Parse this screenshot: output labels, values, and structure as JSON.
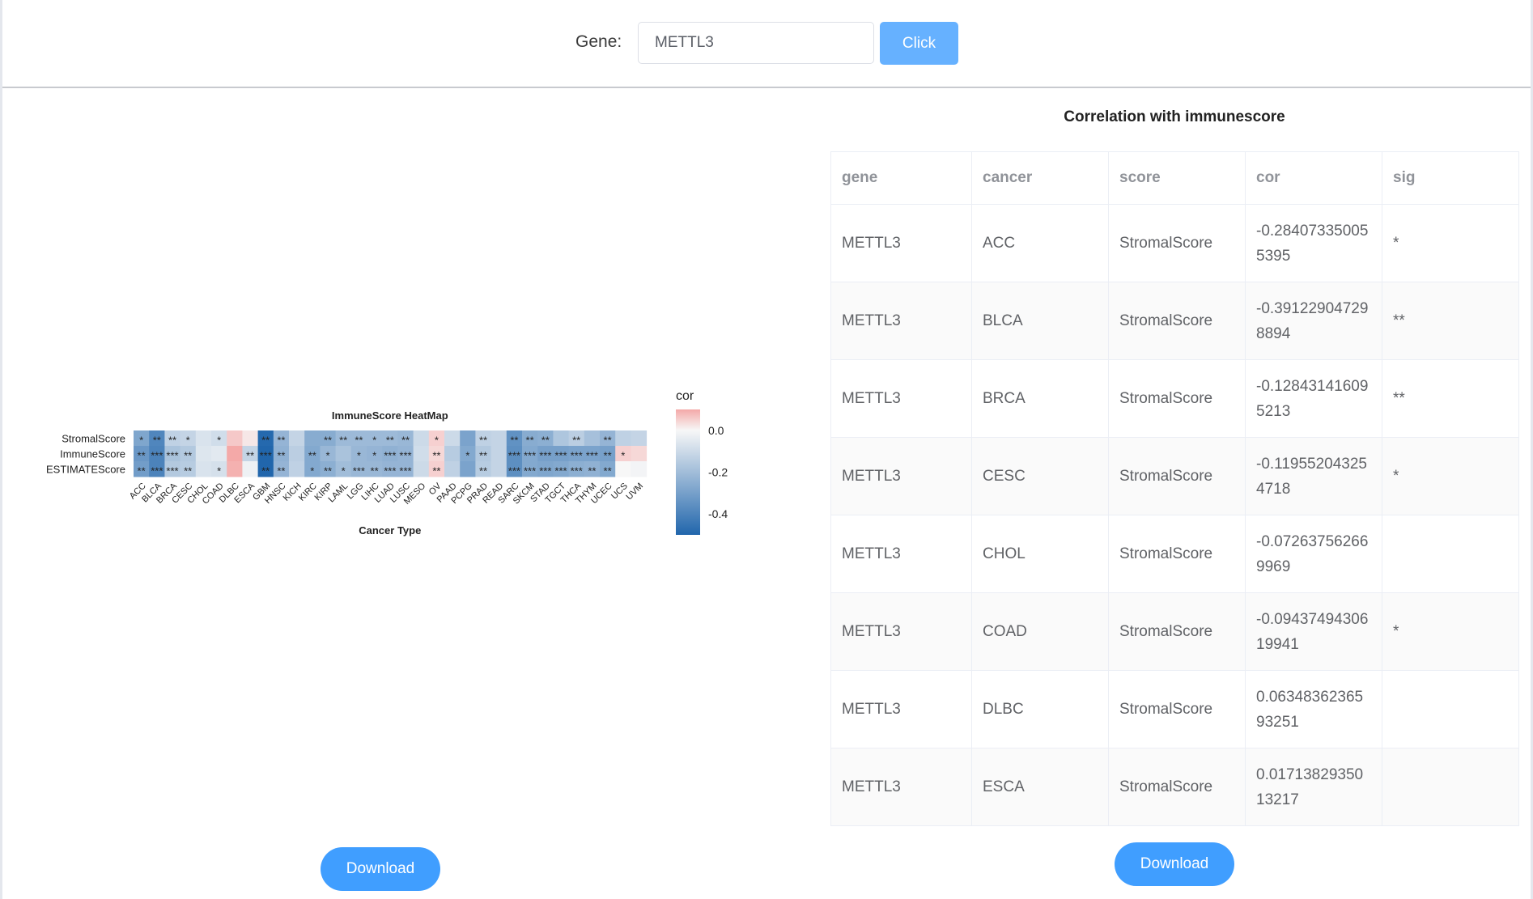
{
  "search": {
    "label": "Gene:",
    "value": "METTL3",
    "button_label": "Click"
  },
  "heatmap": {
    "title": "ImmuneScore HeatMap",
    "xlabel": "Cancer Type",
    "legend_title": "cor",
    "legend_ticks": [
      "0.0",
      "-0.2",
      "-0.4"
    ],
    "download_label": "Download"
  },
  "chart_data": {
    "type": "heatmap",
    "title": "ImmuneScore HeatMap",
    "xlabel": "Cancer Type",
    "ylabel": "",
    "rows": [
      "StromalScore",
      "ImmuneScore",
      "ESTIMATEScore"
    ],
    "columns": [
      "ACC",
      "BLCA",
      "BRCA",
      "CESC",
      "CHOL",
      "COAD",
      "DLBC",
      "ESCA",
      "GBM",
      "HNSC",
      "KICH",
      "KIRC",
      "KIRP",
      "LAML",
      "LGG",
      "LIHC",
      "LUAD",
      "LUSC",
      "MESO",
      "OV",
      "PAAD",
      "PCPG",
      "PRAD",
      "READ",
      "SARC",
      "SKCM",
      "STAD",
      "TGCT",
      "THCA",
      "THYM",
      "UCEC",
      "UCS",
      "UVM"
    ],
    "values": [
      [
        -0.28,
        -0.39,
        -0.13,
        -0.12,
        -0.07,
        -0.09,
        0.06,
        0.02,
        -0.49,
        -0.23,
        -0.12,
        -0.26,
        -0.26,
        -0.21,
        -0.21,
        -0.21,
        -0.21,
        -0.22,
        -0.1,
        0.05,
        -0.1,
        -0.29,
        -0.13,
        -0.12,
        -0.35,
        -0.26,
        -0.25,
        -0.17,
        -0.14,
        -0.19,
        -0.23,
        -0.13,
        -0.12
      ],
      [
        -0.33,
        -0.4,
        -0.18,
        -0.16,
        -0.06,
        -0.05,
        0.1,
        -0.12,
        -0.5,
        -0.24,
        -0.14,
        -0.27,
        -0.22,
        -0.18,
        -0.22,
        -0.23,
        -0.24,
        -0.23,
        -0.09,
        0.04,
        -0.15,
        -0.27,
        -0.16,
        -0.12,
        -0.36,
        -0.27,
        -0.3,
        -0.3,
        -0.29,
        -0.29,
        -0.3,
        0.05,
        0.04
      ],
      [
        -0.31,
        -0.4,
        -0.16,
        -0.15,
        -0.07,
        -0.08,
        0.09,
        -0.02,
        -0.5,
        -0.23,
        -0.13,
        -0.27,
        -0.25,
        -0.2,
        -0.22,
        -0.22,
        -0.23,
        -0.23,
        -0.1,
        0.05,
        -0.13,
        -0.29,
        -0.15,
        -0.12,
        -0.36,
        -0.27,
        -0.28,
        -0.27,
        -0.25,
        -0.24,
        -0.27,
        0.0,
        -0.01
      ]
    ],
    "sig": [
      [
        "*",
        "**",
        "**",
        "*",
        "",
        "*",
        "",
        "",
        "**",
        "**",
        "",
        "",
        "**",
        "**",
        "**",
        "*",
        "**",
        "**",
        "",
        "*",
        "",
        "",
        "**",
        "",
        "**",
        "**",
        "**",
        "",
        "**",
        "",
        "**",
        "",
        ""
      ],
      [
        "**",
        "***",
        "***",
        "**",
        "",
        "",
        "",
        "**",
        "***",
        "**",
        "",
        "**",
        "*",
        "",
        "*",
        "*",
        "***",
        "***",
        "",
        "**",
        "",
        "*",
        "**",
        "",
        "***",
        "***",
        "***",
        "***",
        "***",
        "***",
        "**",
        "*",
        ""
      ],
      [
        "**",
        "***",
        "***",
        "**",
        "",
        "*",
        "",
        "",
        "**",
        "**",
        "",
        "*",
        "**",
        "*",
        "***",
        "**",
        "***",
        "***",
        "",
        "**",
        "",
        "",
        "**",
        "",
        "***",
        "***",
        "***",
        "***",
        "***",
        "**",
        "**",
        "",
        ""
      ]
    ],
    "colorbar": {
      "min": -0.5,
      "max": 0.1,
      "ticks": [
        0.0,
        -0.2,
        -0.4
      ],
      "low_color": "#2166ac",
      "mid_color": "#f7f7f7",
      "high_color": "#f4a9a8"
    }
  },
  "table": {
    "title": "Correlation with immunescore",
    "headers": [
      "gene",
      "cancer",
      "score",
      "cor",
      "sig"
    ],
    "rows": [
      {
        "gene": "METTL3",
        "cancer": "ACC",
        "score": "StromalScore",
        "cor": "-0.284073350055395",
        "sig": "*"
      },
      {
        "gene": "METTL3",
        "cancer": "BLCA",
        "score": "StromalScore",
        "cor": "-0.391229047298894",
        "sig": "**"
      },
      {
        "gene": "METTL3",
        "cancer": "BRCA",
        "score": "StromalScore",
        "cor": "-0.128431416095213",
        "sig": "**"
      },
      {
        "gene": "METTL3",
        "cancer": "CESC",
        "score": "StromalScore",
        "cor": "-0.119552043254718",
        "sig": "*"
      },
      {
        "gene": "METTL3",
        "cancer": "CHOL",
        "score": "StromalScore",
        "cor": "-0.072637562669969",
        "sig": ""
      },
      {
        "gene": "METTL3",
        "cancer": "COAD",
        "score": "StromalScore",
        "cor": "-0.0943749430619941",
        "sig": "*"
      },
      {
        "gene": "METTL3",
        "cancer": "DLBC",
        "score": "StromalScore",
        "cor": "0.0634836236593251",
        "sig": ""
      },
      {
        "gene": "METTL3",
        "cancer": "ESCA",
        "score": "StromalScore",
        "cor": "0.0171382935013217",
        "sig": ""
      }
    ],
    "download_label": "Download"
  },
  "colors": {
    "primary": "#409eff",
    "primary_light": "#66b1ff",
    "stripe": "#fafafa",
    "border": "#ebeef5"
  }
}
